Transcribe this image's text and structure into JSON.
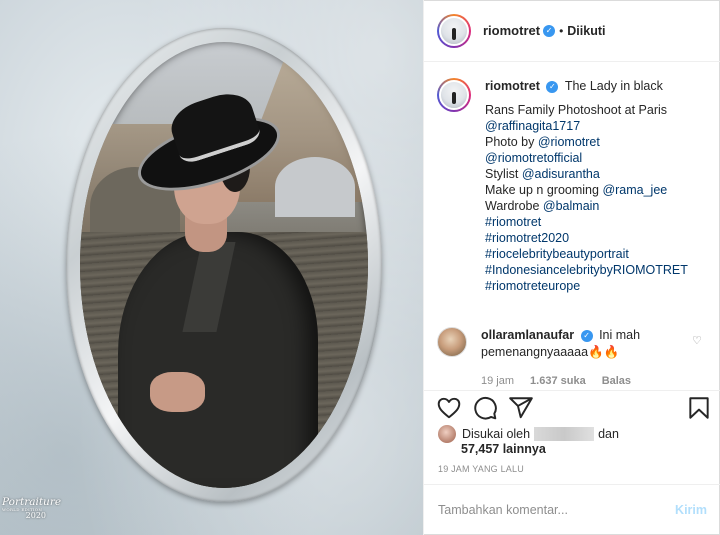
{
  "header": {
    "username": "riomotret",
    "separator": "•",
    "follow_label": "Diikuti"
  },
  "caption": {
    "username": "riomotret",
    "headline": "The Lady in black",
    "lines": [
      {
        "text": "Rans Family Photoshoot at Paris",
        "type": "text"
      },
      {
        "text": "@raffinagita1717",
        "type": "link"
      },
      {
        "prefix": "Photo by ",
        "link": "@riomotret"
      },
      {
        "text": "@riomotretofficial",
        "type": "link"
      },
      {
        "prefix": "Stylist ",
        "link": "@adisurantha"
      },
      {
        "prefix": "Make up n grooming ",
        "link": "@rama_jee"
      },
      {
        "prefix": "Wardrobe ",
        "link": "@balmain"
      },
      {
        "text": "#riomotret",
        "type": "link"
      },
      {
        "text": "#riomotret2020",
        "type": "link"
      },
      {
        "text": "#riocelebritybeautyportrait",
        "type": "link"
      },
      {
        "text": "#IndonesiancelebritybyRIOMOTRET",
        "type": "link"
      },
      {
        "text": "#riomotreteurope",
        "type": "link"
      }
    ]
  },
  "comment": {
    "username": "ollaramlanaufar",
    "text": "Ini mah pemenangnyaaaaa🔥🔥",
    "time": "19 jam",
    "likes": "1.637 suka",
    "reply_label": "Balas"
  },
  "likes": {
    "liked_by_prefix": "Disukai oleh",
    "liked_by_suffix": "dan",
    "count": "57,457 lainnya"
  },
  "timestamp": "19 JAM YANG LALU",
  "add_comment": {
    "placeholder": "Tambahkan komentar...",
    "post_label": "Kirim"
  },
  "watermark": {
    "line1": "Portraiture",
    "line2": "WORLD EDITION",
    "line3": "2020"
  },
  "icons": [
    "verified-badge-icon",
    "heart-icon",
    "comment-icon",
    "share-icon",
    "bookmark-icon"
  ],
  "colors": {
    "link": "#00376b",
    "verified": "#3897f0",
    "post_button": "#b2dffc",
    "muted": "#8e8e8e"
  }
}
